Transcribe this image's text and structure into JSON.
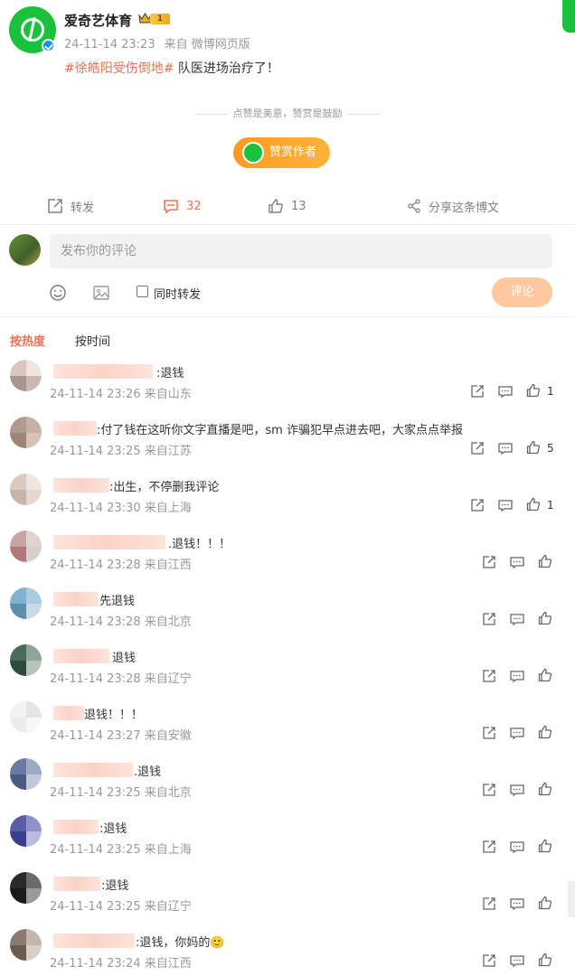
{
  "post": {
    "author": "爱奇艺体育",
    "level": "1",
    "timestamp": "24-11-14 23:23",
    "source": "来自 微博网页版",
    "hashtag": "#徐皓阳受伤倒地#",
    "text": " 队医进场治疗了！",
    "reward_tip": "点赞是美意，赞赏是鼓励",
    "reward_button": "赞赏作者",
    "colors": {
      "accent": "#eb7350",
      "brand_green": "#19c23a",
      "reward_orange": "#ff9a1f"
    }
  },
  "actions": {
    "repost": "转发",
    "comments": "32",
    "likes": "13",
    "share": "分享这条博文"
  },
  "composer": {
    "placeholder": "发布你的评论",
    "repost_label": "同时转发",
    "submit": "评论"
  },
  "sort": {
    "hot": "按热度",
    "time": "按时间"
  },
  "comments": [
    {
      "text": ":退钱",
      "time": "24-11-14 23:26",
      "location": "来自山东",
      "likes": "1"
    },
    {
      "text": ":付了钱在这听你文字直播是吧，sm 诈骗犯早点进去吧，大家点点举报",
      "time": "24-11-14 23:25",
      "location": "来自江苏",
      "likes": "5"
    },
    {
      "text": ":出生，不停删我评论",
      "time": "24-11-14 23:30",
      "location": "来自上海",
      "likes": "1"
    },
    {
      "text": ".退钱！！！",
      "time": "24-11-14 23:28",
      "location": "来自江西",
      "likes": ""
    },
    {
      "text": "先退钱",
      "time": "24-11-14 23:28",
      "location": "来自北京",
      "likes": ""
    },
    {
      "text": "退钱",
      "time": "24-11-14 23:28",
      "location": "来自辽宁",
      "likes": ""
    },
    {
      "text": "退钱！！！",
      "time": "24-11-14 23:27",
      "location": "来自安徽",
      "likes": ""
    },
    {
      "text": ".退钱",
      "time": "24-11-14 23:25",
      "location": "来自北京",
      "likes": ""
    },
    {
      "text": ":退钱",
      "time": "24-11-14 23:25",
      "location": "来自上海",
      "likes": ""
    },
    {
      "text": ":退钱",
      "time": "24-11-14 23:25",
      "location": "来自辽宁",
      "likes": ""
    },
    {
      "text": ":退钱，你妈的🙂",
      "time": "24-11-14 23:24",
      "location": "来自江西",
      "likes": ""
    }
  ]
}
